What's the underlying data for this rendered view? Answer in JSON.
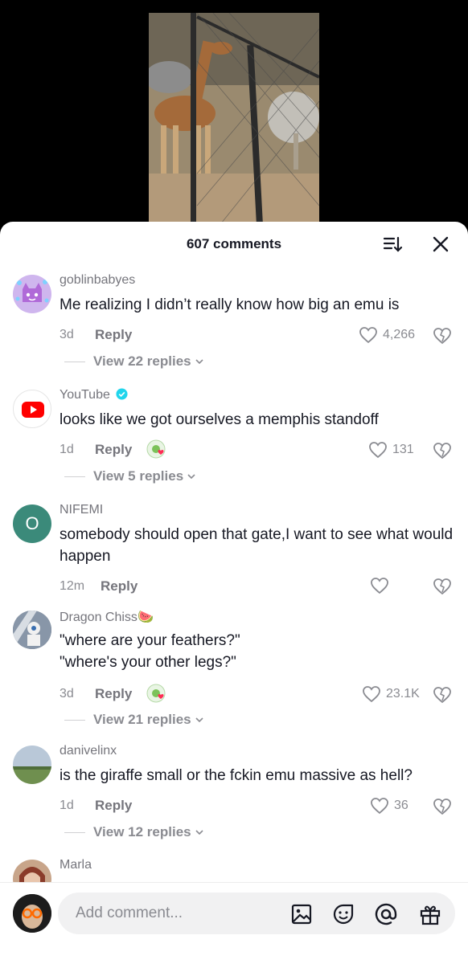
{
  "sheet": {
    "comment_count": "607 comments",
    "sort_icon": "sort-icon",
    "close_icon": "close-icon"
  },
  "comments": [
    {
      "username": "goblinbabyes",
      "text": "Me realizing I didn’t really know how big an emu is",
      "time": "3d",
      "reply_label": "Reply",
      "likes": "4,266",
      "view_replies": "View 22 replies",
      "avatar": "purple-cat-avatar"
    },
    {
      "username": "YouTube",
      "verified": true,
      "text": "looks like we got ourselves a memphis standoff",
      "time": "1d",
      "reply_label": "Reply",
      "likes": "131",
      "view_replies": "View 5 replies",
      "avatar": "youtube-logo-avatar"
    },
    {
      "username": "NIFEMI",
      "avatar_letter": "O",
      "text": "somebody should open that gate,I want to see what would happen",
      "time": "12m",
      "reply_label": "Reply",
      "likes": ""
    },
    {
      "username": "Dragon Chiss",
      "username_emoji": "🍉",
      "text_line1": "\"where are your feathers?\"",
      "text_line2": "\"where's your other legs?\"",
      "time": "3d",
      "reply_label": "Reply",
      "likes": "23.1K",
      "view_replies": "View 21 replies",
      "avatar": "dragon-avatar"
    },
    {
      "username": "danivelinx",
      "text": "is the giraffe small or the fckin emu massive as hell?",
      "time": "1d",
      "reply_label": "Reply",
      "likes": "36",
      "view_replies": "View 12 replies",
      "avatar": "landscape-avatar"
    },
    {
      "username": "Marla",
      "avatar": "portrait-avatar"
    }
  ],
  "composer": {
    "placeholder": "Add comment..."
  },
  "colors": {
    "accent_like": "#8a8b91",
    "youtube_red": "#ff0000",
    "verified_blue": "#20d5ec",
    "nifemi_avatar": "#3b8a7a"
  }
}
